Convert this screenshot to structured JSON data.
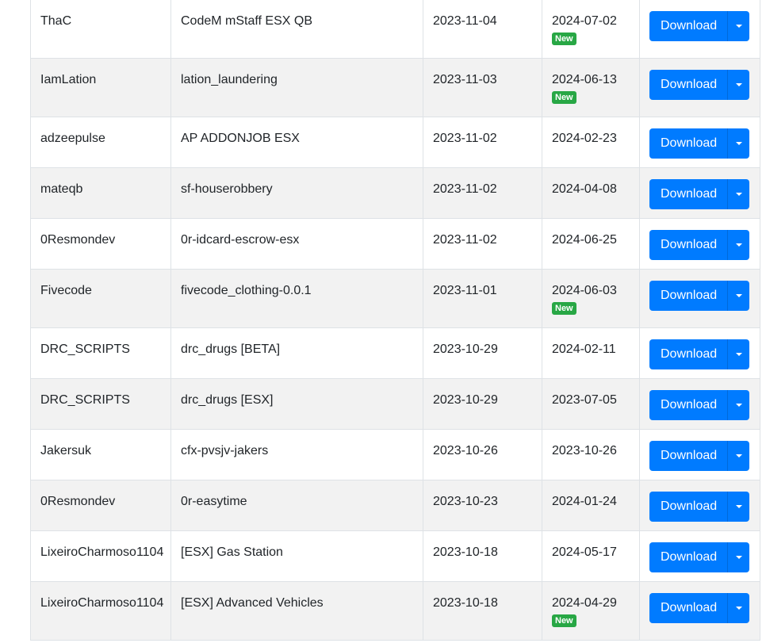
{
  "download_label": "Download",
  "new_badge_label": "New",
  "colors": {
    "primary_button": "#007bff",
    "new_badge": "#28a745",
    "stripe": "#f2f2f2"
  },
  "rows": [
    {
      "author": "ThaC",
      "name": "CodeM mStaff ESX QB",
      "created": "2023-11-04",
      "updated": "2024-07-02",
      "is_new": true
    },
    {
      "author": "IamLation",
      "name": "lation_laundering",
      "created": "2023-11-03",
      "updated": "2024-06-13",
      "is_new": true
    },
    {
      "author": "adzeepulse",
      "name": "AP ADDONJOB ESX",
      "created": "2023-11-02",
      "updated": "2024-02-23",
      "is_new": false
    },
    {
      "author": "mateqb",
      "name": "sf-houserobbery",
      "created": "2023-11-02",
      "updated": "2024-04-08",
      "is_new": false
    },
    {
      "author": "0Resmondev",
      "name": "0r-idcard-escrow-esx",
      "created": "2023-11-02",
      "updated": "2024-06-25",
      "is_new": false
    },
    {
      "author": "Fivecode",
      "name": "fivecode_clothing-0.0.1",
      "created": "2023-11-01",
      "updated": "2024-06-03",
      "is_new": true
    },
    {
      "author": "DRC_SCRIPTS",
      "name": "drc_drugs [BETA]",
      "created": "2023-10-29",
      "updated": "2024-02-11",
      "is_new": false
    },
    {
      "author": "DRC_SCRIPTS",
      "name": "drc_drugs [ESX]",
      "created": "2023-10-29",
      "updated": "2023-07-05",
      "is_new": false
    },
    {
      "author": "Jakersuk",
      "name": "cfx-pvsjv-jakers",
      "created": "2023-10-26",
      "updated": "2023-10-26",
      "is_new": false
    },
    {
      "author": "0Resmondev",
      "name": "0r-easytime",
      "created": "2023-10-23",
      "updated": "2024-01-24",
      "is_new": false
    },
    {
      "author": "LixeiroCharmoso1104",
      "name": "[ESX] Gas Station",
      "created": "2023-10-18",
      "updated": "2024-05-17",
      "is_new": false
    },
    {
      "author": "LixeiroCharmoso1104",
      "name": "[ESX] Advanced Vehicles",
      "created": "2023-10-18",
      "updated": "2024-04-29",
      "is_new": true
    }
  ]
}
